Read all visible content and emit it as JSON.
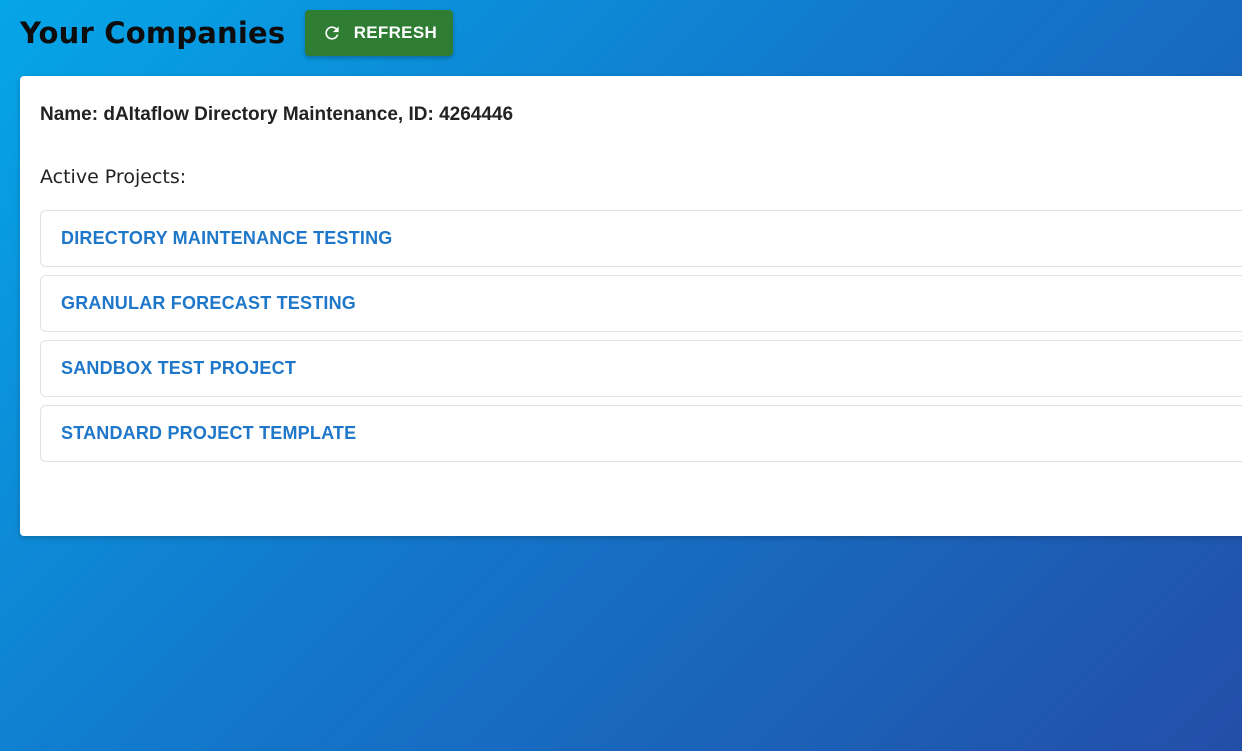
{
  "header": {
    "title": "Your Companies",
    "refresh_label": "REFRESH",
    "refresh_icon": "refresh-icon"
  },
  "company": {
    "name_line": "Name: dAItaflow Directory Maintenance, ID: 4264446",
    "projects_label": "Active Projects:",
    "projects": [
      {
        "label": "DIRECTORY MAINTENANCE TESTING"
      },
      {
        "label": "GRANULAR FORECAST TESTING"
      },
      {
        "label": "SANDBOX TEST PROJECT"
      },
      {
        "label": "STANDARD PROJECT TEMPLATE"
      }
    ]
  },
  "colors": {
    "refresh_button": "#2e7d32",
    "project_link": "#1f77c9",
    "background_start": "#05a6e8",
    "background_end": "#234ea8"
  }
}
